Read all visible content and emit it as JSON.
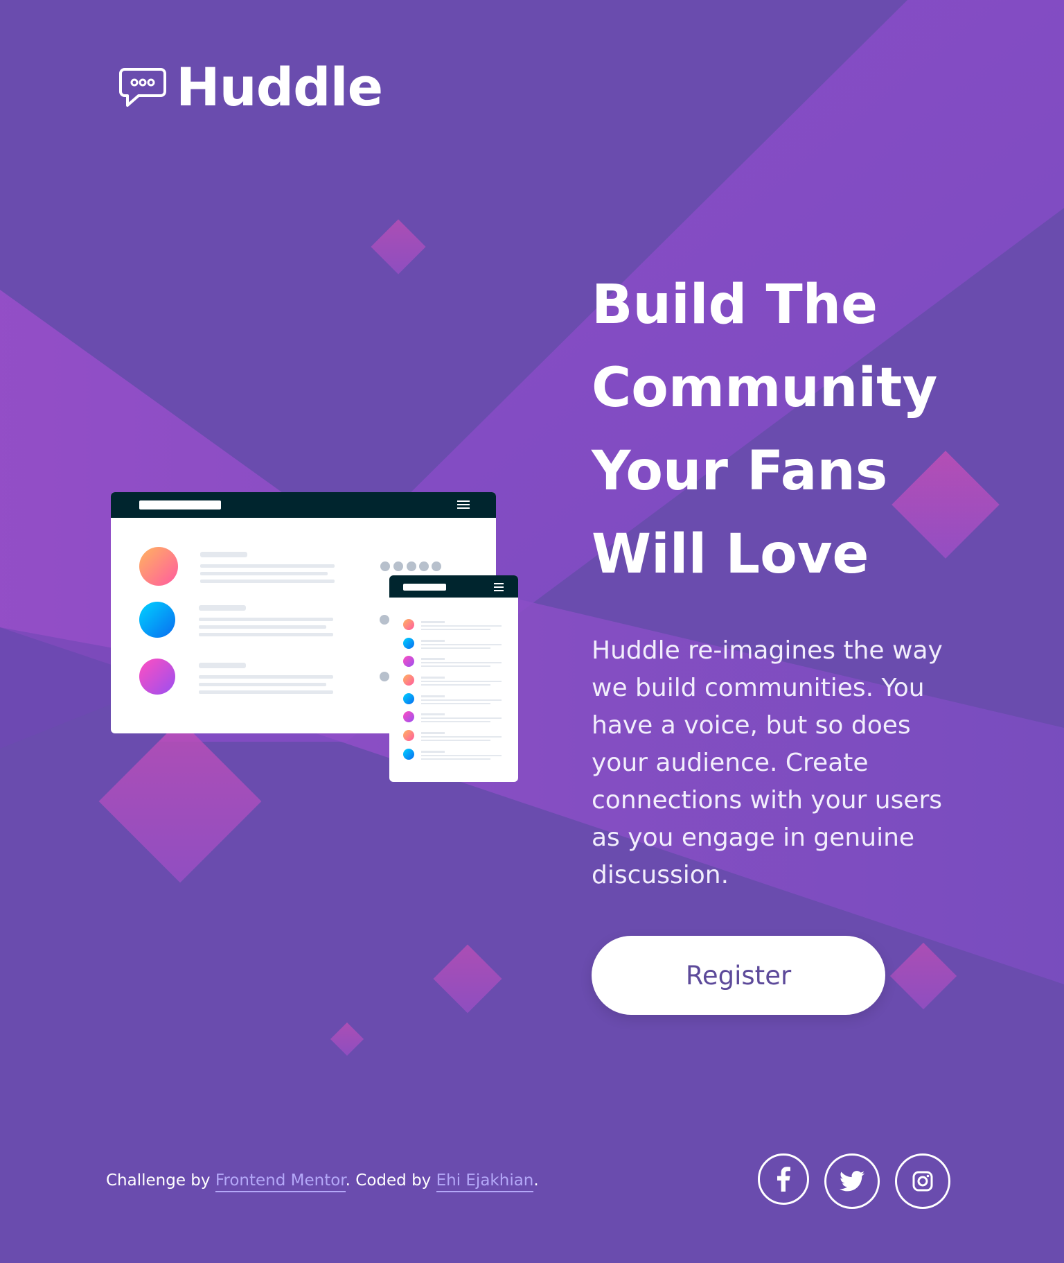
{
  "brand": {
    "name": "Huddle",
    "logo_icon": "chat-bubble-icon"
  },
  "hero": {
    "headline_lines": [
      "Build The",
      "Community",
      "Your Fans",
      "Will Love"
    ],
    "description": "Huddle re-imagines the way we build communities. You have a voice, but so does your audience. Create connections with your users as you engage in genuine discussion.",
    "register_label": "Register"
  },
  "footer": {
    "challenge_prefix": "Challenge by",
    "challenge_link": "Frontend Mentor",
    "coded_prefix": ". Coded by",
    "coded_link": "Ehi Ejakhian",
    "suffix": "."
  },
  "social": [
    "facebook-icon",
    "twitter-icon",
    "instagram-icon"
  ],
  "colors": {
    "background": "#6a4cae",
    "accent_purple": "#9b4fcc",
    "diamond": "#b84fc0",
    "button_text": "#5d4a9a",
    "link": "#b4a8f8",
    "mockup_header": "#00252e"
  }
}
